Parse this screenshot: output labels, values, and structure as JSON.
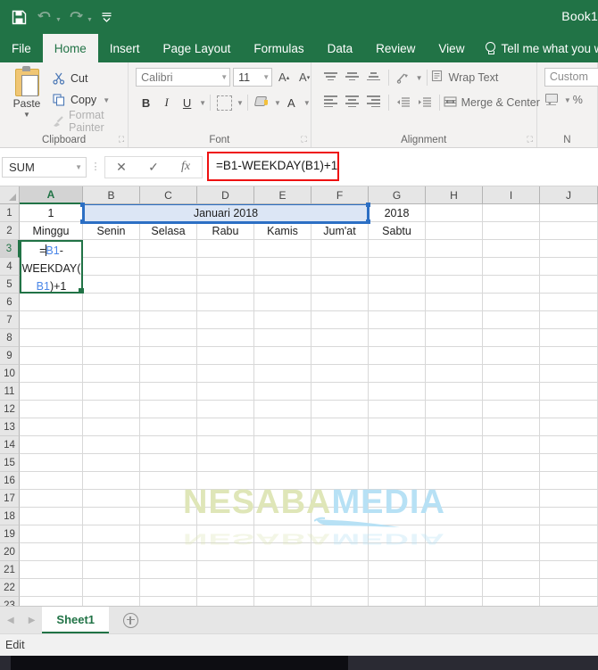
{
  "titlebar": {
    "document_title": "Book1",
    "qat": [
      {
        "name": "save-icon",
        "label": "Save"
      },
      {
        "name": "undo-icon",
        "label": "Undo"
      },
      {
        "name": "redo-icon",
        "label": "Redo"
      },
      {
        "name": "customize-qat-icon",
        "label": "Customize Quick Access Toolbar"
      }
    ]
  },
  "ribbon": {
    "tabs": [
      {
        "label": "File",
        "active": false
      },
      {
        "label": "Home",
        "active": true
      },
      {
        "label": "Insert",
        "active": false
      },
      {
        "label": "Page Layout",
        "active": false
      },
      {
        "label": "Formulas",
        "active": false
      },
      {
        "label": "Data",
        "active": false
      },
      {
        "label": "Review",
        "active": false
      },
      {
        "label": "View",
        "active": false
      }
    ],
    "tell_me": "Tell me what you want",
    "groups": {
      "clipboard": {
        "label": "Clipboard",
        "paste_label": "Paste",
        "cut_label": "Cut",
        "copy_label": "Copy",
        "format_painter_label": "Format Painter"
      },
      "font": {
        "label": "Font",
        "font_name": "Calibri",
        "font_size": "11",
        "bold_label": "B",
        "italic_label": "I",
        "underline_label": "U",
        "grow_label": "A",
        "shrink_label": "A",
        "font_color_label": "A"
      },
      "alignment": {
        "label": "Alignment",
        "wrap_text_label": "Wrap Text",
        "merge_center_label": "Merge & Center"
      },
      "number": {
        "label": "N",
        "format_value": "Custom",
        "percent_label": "%"
      }
    }
  },
  "formula_bar": {
    "name_box_value": "SUM",
    "cancel_label": "✕",
    "enter_label": "✓",
    "insert_function_label": "fx",
    "formula_value": "=B1-WEEKDAY(B1)+1",
    "highlight_color": "#ee1111"
  },
  "grid": {
    "columns": [
      "A",
      "B",
      "C",
      "D",
      "E",
      "F",
      "G",
      "H",
      "I",
      "J"
    ],
    "rows": [
      1,
      2,
      3,
      4,
      5,
      6,
      7,
      8,
      9,
      10,
      11,
      12,
      13,
      14,
      15,
      16,
      17,
      18,
      19,
      20,
      21,
      22,
      23
    ],
    "selected_column": "A",
    "selected_row": 3,
    "cells": {
      "A1": "1",
      "G1": "2018",
      "A2": "Minggu",
      "B2": "Senin",
      "C2": "Selasa",
      "D2": "Rabu",
      "E2": "Kamis",
      "F2": "Jum'at",
      "G2": "Sabtu"
    },
    "merged_cell": {
      "range": "B1:F1",
      "value": "Januari 2018",
      "highlight_color": "#dce6f5",
      "border_color": "#2c6fc4"
    },
    "editing_cell": {
      "address": "A3",
      "line1_prefix": "=",
      "line1_ref": "B1",
      "line1_suffix": "-",
      "line2": "WEEKDAY(",
      "line3_ref": "B1",
      "line3_suffix": ")+1",
      "border_color": "#217346"
    },
    "watermark": {
      "part1": "NESABA",
      "part2": "MEDIA",
      "color1": "#dfe6b8",
      "color2": "#b7e1f5"
    }
  },
  "sheetbar": {
    "prev_label": "◀",
    "next_label": "▶",
    "tabs": [
      {
        "label": "Sheet1",
        "active": true
      }
    ],
    "add_sheet_label": "+"
  },
  "statusbar": {
    "mode": "Edit"
  }
}
